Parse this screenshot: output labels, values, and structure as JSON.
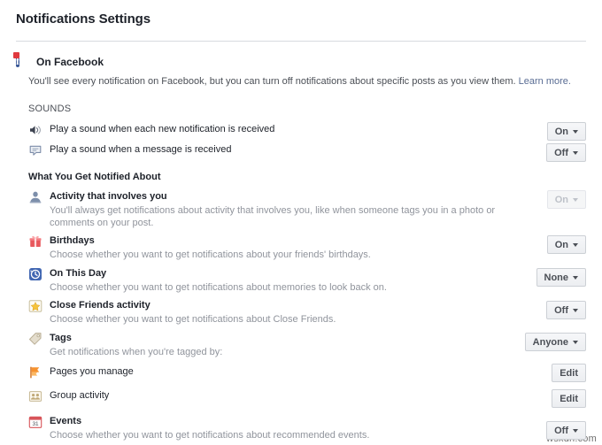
{
  "header": {
    "title": "Notifications Settings"
  },
  "on_facebook": {
    "label": "On Facebook",
    "icon": "facebook-notification-icon",
    "description": "You'll see every notification on Facebook, but you can turn off notifications about specific posts as you view them.",
    "learn_more": "Learn more."
  },
  "sounds": {
    "heading": "SOUNDS",
    "rows": [
      {
        "icon": "speaker-icon",
        "title": "Play a sound when each new notification is received",
        "desc": "",
        "control": {
          "type": "dropdown",
          "value": "On",
          "disabled": false
        }
      },
      {
        "icon": "message-bubble-icon",
        "title": "Play a sound when a message is received",
        "desc": "",
        "control": {
          "type": "dropdown",
          "value": "Off",
          "disabled": false
        }
      }
    ]
  },
  "notified_about": {
    "heading": "What You Get Notified About",
    "rows": [
      {
        "icon": "person-icon",
        "title": "Activity that involves you",
        "desc": "You'll always get notifications about activity that involves you, like when someone tags you in a photo or comments on your post.",
        "control": {
          "type": "dropdown",
          "value": "On",
          "disabled": true
        }
      },
      {
        "icon": "gift-icon",
        "title": "Birthdays",
        "desc": "Choose whether you want to get notifications about your friends' birthdays.",
        "control": {
          "type": "dropdown",
          "value": "On",
          "disabled": false
        }
      },
      {
        "icon": "clock-history-icon",
        "title": "On This Day",
        "desc": "Choose whether you want to get notifications about memories to look back on.",
        "control": {
          "type": "dropdown",
          "value": "None",
          "disabled": false
        }
      },
      {
        "icon": "star-icon",
        "title": "Close Friends activity",
        "desc": "Choose whether you want to get notifications about Close Friends.",
        "control": {
          "type": "dropdown",
          "value": "Off",
          "disabled": false
        }
      },
      {
        "icon": "tag-icon",
        "title": "Tags",
        "desc": "Get notifications when you're tagged by:",
        "control": {
          "type": "dropdown",
          "value": "Anyone",
          "disabled": false
        }
      },
      {
        "icon": "flag-icon",
        "title": "Pages you manage",
        "desc": "",
        "control": {
          "type": "button",
          "value": "Edit",
          "disabled": false
        }
      },
      {
        "icon": "group-icon",
        "title": "Group activity",
        "desc": "",
        "control": {
          "type": "button",
          "value": "Edit",
          "disabled": false
        }
      },
      {
        "icon": "calendar-icon",
        "title": "Events",
        "desc": "Choose whether you want to get notifications about recommended events.",
        "control": {
          "type": "dropdown",
          "value": "Off",
          "disabled": false
        }
      }
    ]
  },
  "watermark": "wsxdn.com",
  "colors": {
    "brand_blue": "#3b5998",
    "link_blue": "#5a6d94",
    "text_primary": "#1d2129",
    "text_muted": "#90949c",
    "badge_red": "#e0393e"
  }
}
